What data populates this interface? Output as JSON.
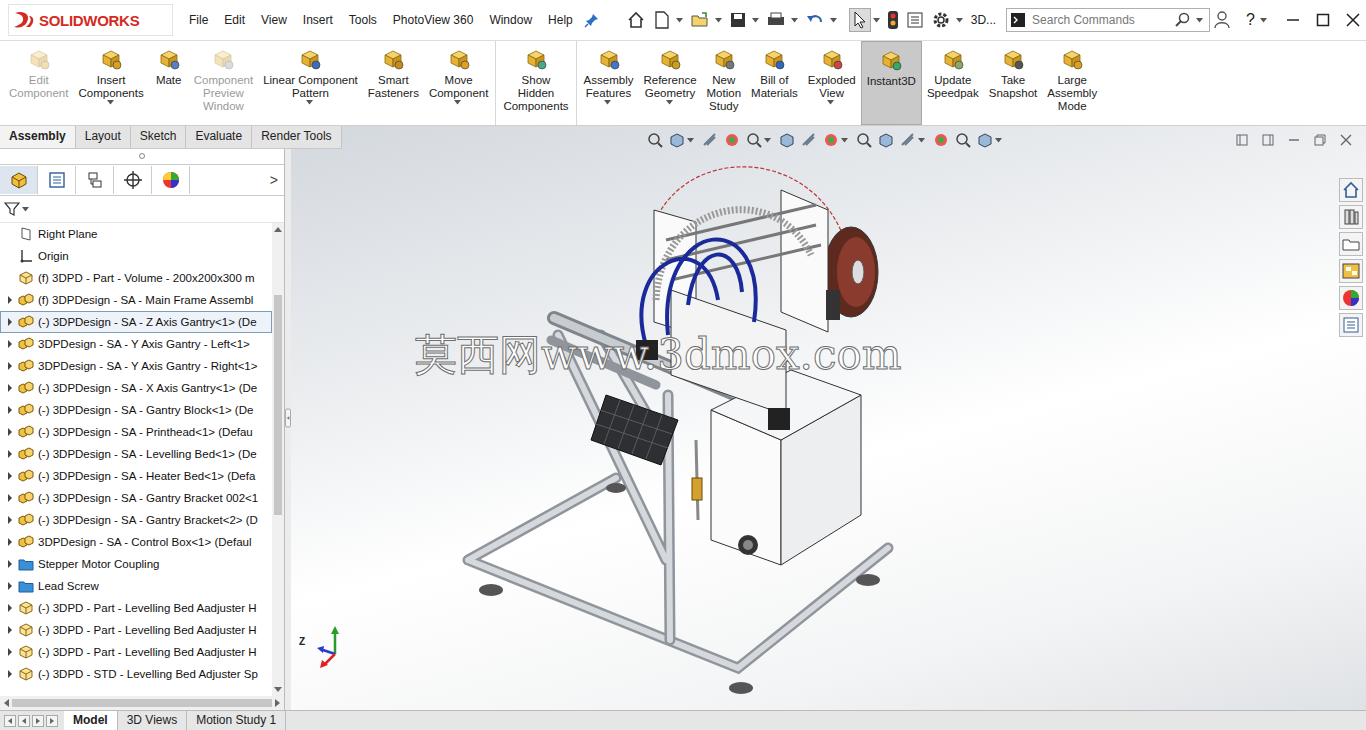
{
  "app": {
    "logo": "SOLIDWORKS"
  },
  "menu": [
    "File",
    "Edit",
    "View",
    "Insert",
    "Tools",
    "PhotoView 360",
    "Window",
    "Help"
  ],
  "toolbar": {
    "overflow_label": "3D..."
  },
  "search": {
    "placeholder": "Search Commands"
  },
  "help": "?",
  "ribbon": {
    "groups": [
      [
        {
          "lines": [
            "Edit",
            "Component"
          ],
          "disabled": true,
          "dropdown": false,
          "selected": false
        },
        {
          "lines": [
            "Insert",
            "Components"
          ],
          "disabled": false,
          "dropdown": true,
          "selected": false
        },
        {
          "lines": [
            "Mate"
          ],
          "disabled": false,
          "dropdown": false,
          "selected": false
        },
        {
          "lines": [
            "Component",
            "Preview",
            "Window"
          ],
          "disabled": true,
          "dropdown": false,
          "selected": false
        },
        {
          "lines": [
            "Linear Component",
            "Pattern"
          ],
          "disabled": false,
          "dropdown": true,
          "selected": false
        },
        {
          "lines": [
            "Smart",
            "Fasteners"
          ],
          "disabled": false,
          "dropdown": false,
          "selected": false
        },
        {
          "lines": [
            "Move",
            "Component"
          ],
          "disabled": false,
          "dropdown": true,
          "selected": false
        }
      ],
      [
        {
          "lines": [
            "Show",
            "Hidden",
            "Components"
          ],
          "disabled": false,
          "dropdown": false,
          "selected": false
        }
      ],
      [
        {
          "lines": [
            "Assembly",
            "Features"
          ],
          "disabled": false,
          "dropdown": true,
          "selected": false
        },
        {
          "lines": [
            "Reference",
            "Geometry"
          ],
          "disabled": false,
          "dropdown": true,
          "selected": false
        },
        {
          "lines": [
            "New",
            "Motion",
            "Study"
          ],
          "disabled": false,
          "dropdown": false,
          "selected": false
        },
        {
          "lines": [
            "Bill of",
            "Materials"
          ],
          "disabled": false,
          "dropdown": false,
          "selected": false
        },
        {
          "lines": [
            "Exploded",
            "View"
          ],
          "disabled": false,
          "dropdown": true,
          "selected": false
        },
        {
          "lines": [
            "Instant3D"
          ],
          "disabled": false,
          "dropdown": false,
          "selected": true
        },
        {
          "lines": [
            "Update",
            "Speedpak"
          ],
          "disabled": false,
          "dropdown": false,
          "selected": false
        },
        {
          "lines": [
            "Take",
            "Snapshot"
          ],
          "disabled": false,
          "dropdown": false,
          "selected": false
        },
        {
          "lines": [
            "Large",
            "Assembly",
            "Mode"
          ],
          "disabled": false,
          "dropdown": false,
          "selected": false
        }
      ]
    ]
  },
  "command_tabs": [
    {
      "label": "Assembly",
      "selected": true
    },
    {
      "label": "Layout",
      "selected": false
    },
    {
      "label": "Sketch",
      "selected": false
    },
    {
      "label": "Evaluate",
      "selected": false
    },
    {
      "label": "Render Tools",
      "selected": false
    }
  ],
  "feature_manager": {
    "more": ">",
    "tabs": [
      {
        "selected": true
      },
      {
        "selected": false
      },
      {
        "selected": false
      },
      {
        "selected": false
      },
      {
        "selected": false
      }
    ],
    "items": [
      {
        "label": "Right Plane",
        "kind": "plane",
        "expandable": false,
        "selected": false
      },
      {
        "label": "Origin",
        "kind": "origin",
        "expandable": false,
        "selected": false
      },
      {
        "label": "(f) 3DPD - Part - Volume - 200x200x300 m",
        "kind": "part",
        "expandable": false,
        "selected": false
      },
      {
        "label": "(f) 3DPDesign - SA - Main Frame Assembl",
        "kind": "assembly",
        "expandable": true,
        "selected": false
      },
      {
        "label": "(-) 3DPDesign - SA - Z Axis Gantry<1> (De",
        "kind": "assembly",
        "expandable": true,
        "selected": true
      },
      {
        "label": "3DPDesign - SA - Y Axis Gantry - Left<1>",
        "kind": "assembly",
        "expandable": true,
        "selected": false
      },
      {
        "label": "3DPDesign - SA - Y Axis Gantry - Right<1>",
        "kind": "assembly",
        "expandable": true,
        "selected": false
      },
      {
        "label": "(-) 3DPDesign - SA - X Axis Gantry<1> (De",
        "kind": "assembly",
        "expandable": true,
        "selected": false
      },
      {
        "label": "(-) 3DPDesign - SA - Gantry Block<1> (De",
        "kind": "assembly",
        "expandable": true,
        "selected": false
      },
      {
        "label": "(-) 3DPDesign - SA - Printhead<1> (Defau",
        "kind": "assembly",
        "expandable": true,
        "selected": false
      },
      {
        "label": "(-) 3DPDesign - SA - Levelling Bed<1> (De",
        "kind": "assembly",
        "expandable": true,
        "selected": false
      },
      {
        "label": "(-) 3DPDesign - SA - Heater Bed<1> (Defa",
        "kind": "assembly",
        "expandable": true,
        "selected": false
      },
      {
        "label": "(-) 3DPDesign - SA - Gantry Bracket 002<1",
        "kind": "assembly",
        "expandable": true,
        "selected": false
      },
      {
        "label": "(-) 3DPDesign - SA - Gantry Bracket<2> (D",
        "kind": "assembly",
        "expandable": true,
        "selected": false
      },
      {
        "label": "3DPDesign - SA - Control Box<1> (Defaul",
        "kind": "assembly",
        "expandable": true,
        "selected": false
      },
      {
        "label": "Stepper Motor Coupling",
        "kind": "folder",
        "expandable": true,
        "selected": false
      },
      {
        "label": "Lead Screw",
        "kind": "folder",
        "expandable": true,
        "selected": false
      },
      {
        "label": "(-) 3DPD - Part - Levelling Bed Aadjuster H",
        "kind": "part",
        "expandable": true,
        "selected": false
      },
      {
        "label": "(-) 3DPD - Part - Levelling Bed Aadjuster H",
        "kind": "part",
        "expandable": true,
        "selected": false
      },
      {
        "label": "(-) 3DPD - Part - Levelling Bed Aadjuster H",
        "kind": "part",
        "expandable": true,
        "selected": false
      },
      {
        "label": "(-) 3DPD - STD - Levelling Bed Adjuster Sp",
        "kind": "part",
        "expandable": true,
        "selected": false
      }
    ]
  },
  "viewport": {
    "watermark": "莫西网www.3dmox.com",
    "triad_label": "Z"
  },
  "bottom_tabs": [
    {
      "label": "Model",
      "selected": true
    },
    {
      "label": "3D Views",
      "selected": false
    },
    {
      "label": "Motion Study 1",
      "selected": false
    }
  ]
}
